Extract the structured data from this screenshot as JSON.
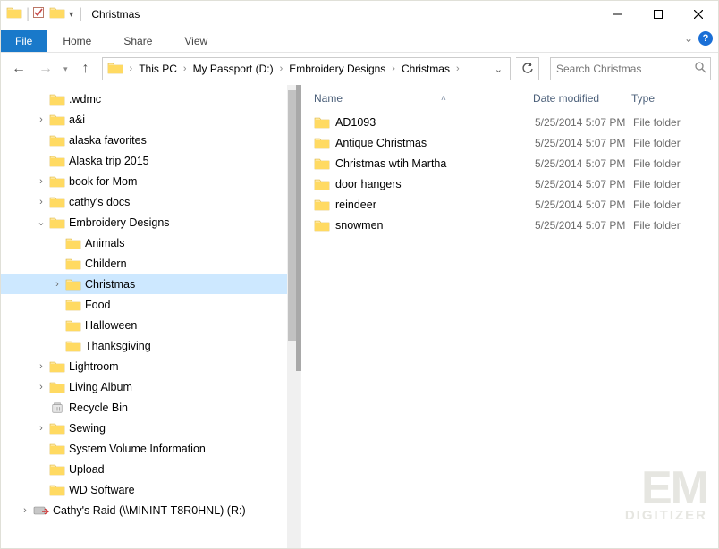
{
  "window": {
    "title": "Christmas"
  },
  "ribbon": {
    "file": "File",
    "tabs": [
      "Home",
      "Share",
      "View"
    ]
  },
  "breadcrumb": {
    "items": [
      "This PC",
      "My Passport (D:)",
      "Embroidery Designs",
      "Christmas"
    ]
  },
  "search": {
    "placeholder": "Search Christmas"
  },
  "tree": [
    {
      "label": ".wdmc",
      "indent": 2,
      "hasChildren": false,
      "icon": "folder"
    },
    {
      "label": "a&i",
      "indent": 2,
      "hasChildren": true,
      "icon": "folder"
    },
    {
      "label": "alaska favorites",
      "indent": 2,
      "hasChildren": false,
      "icon": "folder"
    },
    {
      "label": "Alaska trip 2015",
      "indent": 2,
      "hasChildren": false,
      "icon": "folder"
    },
    {
      "label": "book for Mom",
      "indent": 2,
      "hasChildren": true,
      "icon": "folder"
    },
    {
      "label": "cathy's docs",
      "indent": 2,
      "hasChildren": true,
      "icon": "folder"
    },
    {
      "label": "Embroidery Designs",
      "indent": 2,
      "hasChildren": true,
      "expanded": true,
      "icon": "folder"
    },
    {
      "label": "Animals",
      "indent": 3,
      "hasChildren": false,
      "icon": "folder"
    },
    {
      "label": "Childern",
      "indent": 3,
      "hasChildren": false,
      "icon": "folder"
    },
    {
      "label": "Christmas",
      "indent": 3,
      "hasChildren": true,
      "selected": true,
      "icon": "folder"
    },
    {
      "label": "Food",
      "indent": 3,
      "hasChildren": false,
      "icon": "folder"
    },
    {
      "label": "Halloween",
      "indent": 3,
      "hasChildren": false,
      "icon": "folder"
    },
    {
      "label": "Thanksgiving",
      "indent": 3,
      "hasChildren": false,
      "icon": "folder"
    },
    {
      "label": "Lightroom",
      "indent": 2,
      "hasChildren": true,
      "icon": "folder"
    },
    {
      "label": "Living Album",
      "indent": 2,
      "hasChildren": true,
      "icon": "folder"
    },
    {
      "label": "Recycle Bin",
      "indent": 2,
      "hasChildren": false,
      "icon": "recycle"
    },
    {
      "label": "Sewing",
      "indent": 2,
      "hasChildren": true,
      "icon": "folder"
    },
    {
      "label": "System Volume Information",
      "indent": 2,
      "hasChildren": false,
      "icon": "folder"
    },
    {
      "label": "Upload",
      "indent": 2,
      "hasChildren": false,
      "icon": "folder"
    },
    {
      "label": "WD Software",
      "indent": 2,
      "hasChildren": false,
      "icon": "folder"
    },
    {
      "label": "Cathy's Raid (\\\\MININT-T8R0HNL) (R:)",
      "indent": 1,
      "hasChildren": true,
      "icon": "netdrive"
    }
  ],
  "columns": {
    "name": "Name",
    "date": "Date modified",
    "type": "Type"
  },
  "items": [
    {
      "name": "AD1093",
      "date": "5/25/2014 5:07 PM",
      "type": "File folder"
    },
    {
      "name": "Antique Christmas",
      "date": "5/25/2014 5:07 PM",
      "type": "File folder"
    },
    {
      "name": "Christmas wtih Martha",
      "date": "5/25/2014 5:07 PM",
      "type": "File folder"
    },
    {
      "name": "door hangers",
      "date": "5/25/2014 5:07 PM",
      "type": "File folder"
    },
    {
      "name": "reindeer",
      "date": "5/25/2014 5:07 PM",
      "type": "File folder"
    },
    {
      "name": "snowmen",
      "date": "5/25/2014 5:07 PM",
      "type": "File folder"
    }
  ],
  "watermark": {
    "line1": "EM",
    "line2": "DIGITIZER"
  }
}
